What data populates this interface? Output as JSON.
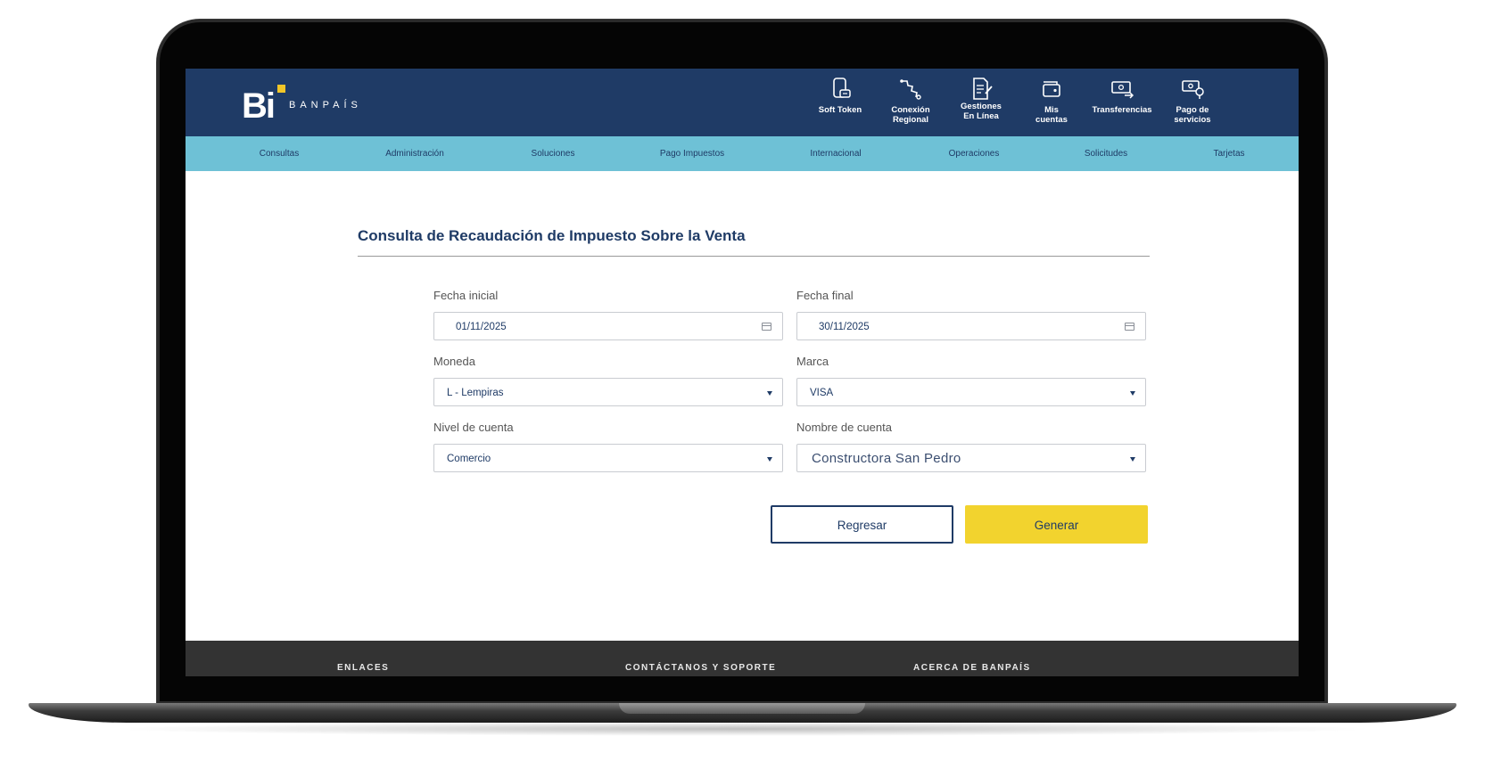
{
  "header": {
    "brand_mark": "Bi",
    "brand_name": "BANPAÍS",
    "shortcuts": [
      {
        "label_line1": "Soft Token",
        "label_line2": "",
        "icon": "phone-token-icon"
      },
      {
        "label_line1": "Conexión",
        "label_line2": "Regional",
        "icon": "regional-connection-icon"
      },
      {
        "label_line1": "Gestiones",
        "label_line2": "En Línea",
        "icon": "online-document-icon"
      },
      {
        "label_line1": "Mis",
        "label_line2": "cuentas",
        "icon": "wallet-icon"
      },
      {
        "label_line1": "Transferencias",
        "label_line2": "",
        "icon": "transfer-icon"
      },
      {
        "label_line1": "Pago de",
        "label_line2": "servicios",
        "icon": "service-payment-icon"
      }
    ]
  },
  "nav": {
    "items": [
      "Consultas",
      "Administración",
      "Soluciones",
      "Pago Impuestos",
      "Internacional",
      "Operaciones",
      "Solicitudes",
      "Tarjetas"
    ]
  },
  "form": {
    "title": "Consulta de Recaudación de Impuesto Sobre la Venta",
    "start_date": {
      "label": "Fecha inicial",
      "value": "01/11/2025"
    },
    "end_date": {
      "label": "Fecha final",
      "value": "30/11/2025"
    },
    "currency": {
      "label": "Moneda",
      "value": "L - Lempiras"
    },
    "brand": {
      "label": "Marca",
      "value": "VISA"
    },
    "account_level": {
      "label": "Nivel de cuenta",
      "value": "Comercio"
    },
    "account_name": {
      "label": "Nombre de cuenta",
      "value": "Constructora San Pedro"
    },
    "back_label": "Regresar",
    "generate_label": "Generar"
  },
  "footer": {
    "links_heading": "ENLACES",
    "contact_heading": "CONTÁCTANOS Y SOPORTE",
    "about_heading": "ACERCA DE BANPAÍS"
  },
  "colors": {
    "header_bg": "#1f3b66",
    "nav_bg": "#6ec1d6",
    "accent_yellow": "#f2d32e",
    "footer_bg": "#333333"
  }
}
